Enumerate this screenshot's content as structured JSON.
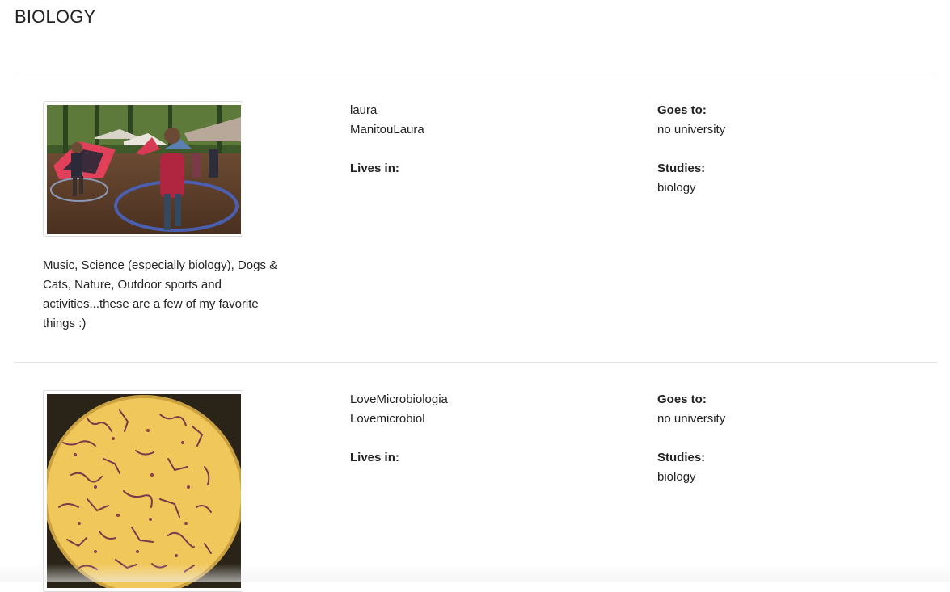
{
  "page": {
    "title": "BIOLOGY"
  },
  "labels": {
    "goes_to": "Goes to:",
    "lives_in": "Lives in:",
    "studies": "Studies:"
  },
  "profiles": [
    {
      "name": "laura",
      "username": "ManitouLaura",
      "lives_in": "",
      "goes_to": "no university",
      "studies": "biology",
      "bio": "Music, Science (especially biology), Dogs & Cats, Nature, Outdoor sports and activities...these are a few of my favorite things :)",
      "photo": "camping-hula-hoop-photo"
    },
    {
      "name": "LoveMicrobiologia",
      "username": "Lovemicrobiol",
      "lives_in": "",
      "goes_to": "no university",
      "studies": "biology",
      "bio": "",
      "photo": "microscope-bacteria-photo"
    }
  ]
}
